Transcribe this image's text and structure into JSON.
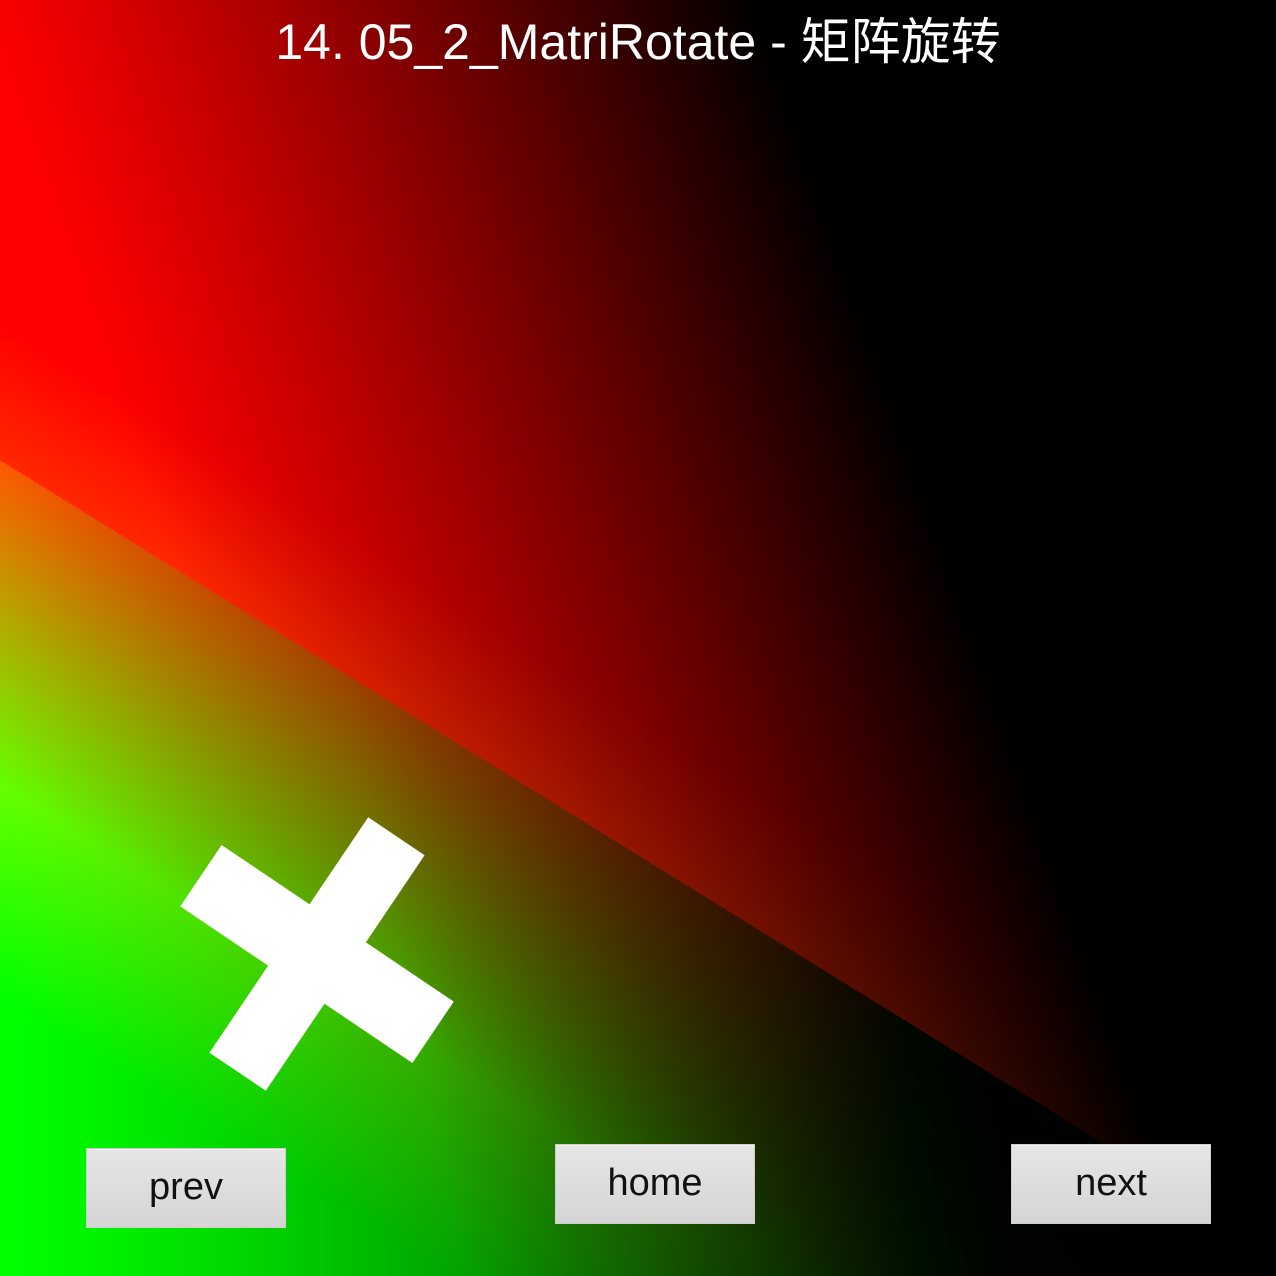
{
  "title": "14.  05_2_MatriRotate - 矩阵旋转",
  "buttons": {
    "prev": "prev",
    "home": "home",
    "next": "next"
  },
  "colors": {
    "top_left": "#ff0000",
    "top_right": "#000000",
    "bottom_left": "#ffff00",
    "bottom_right": "#000000",
    "green_mid": "#00c800",
    "cross": "#ffffff",
    "button_bg": "#dcdcdc"
  }
}
